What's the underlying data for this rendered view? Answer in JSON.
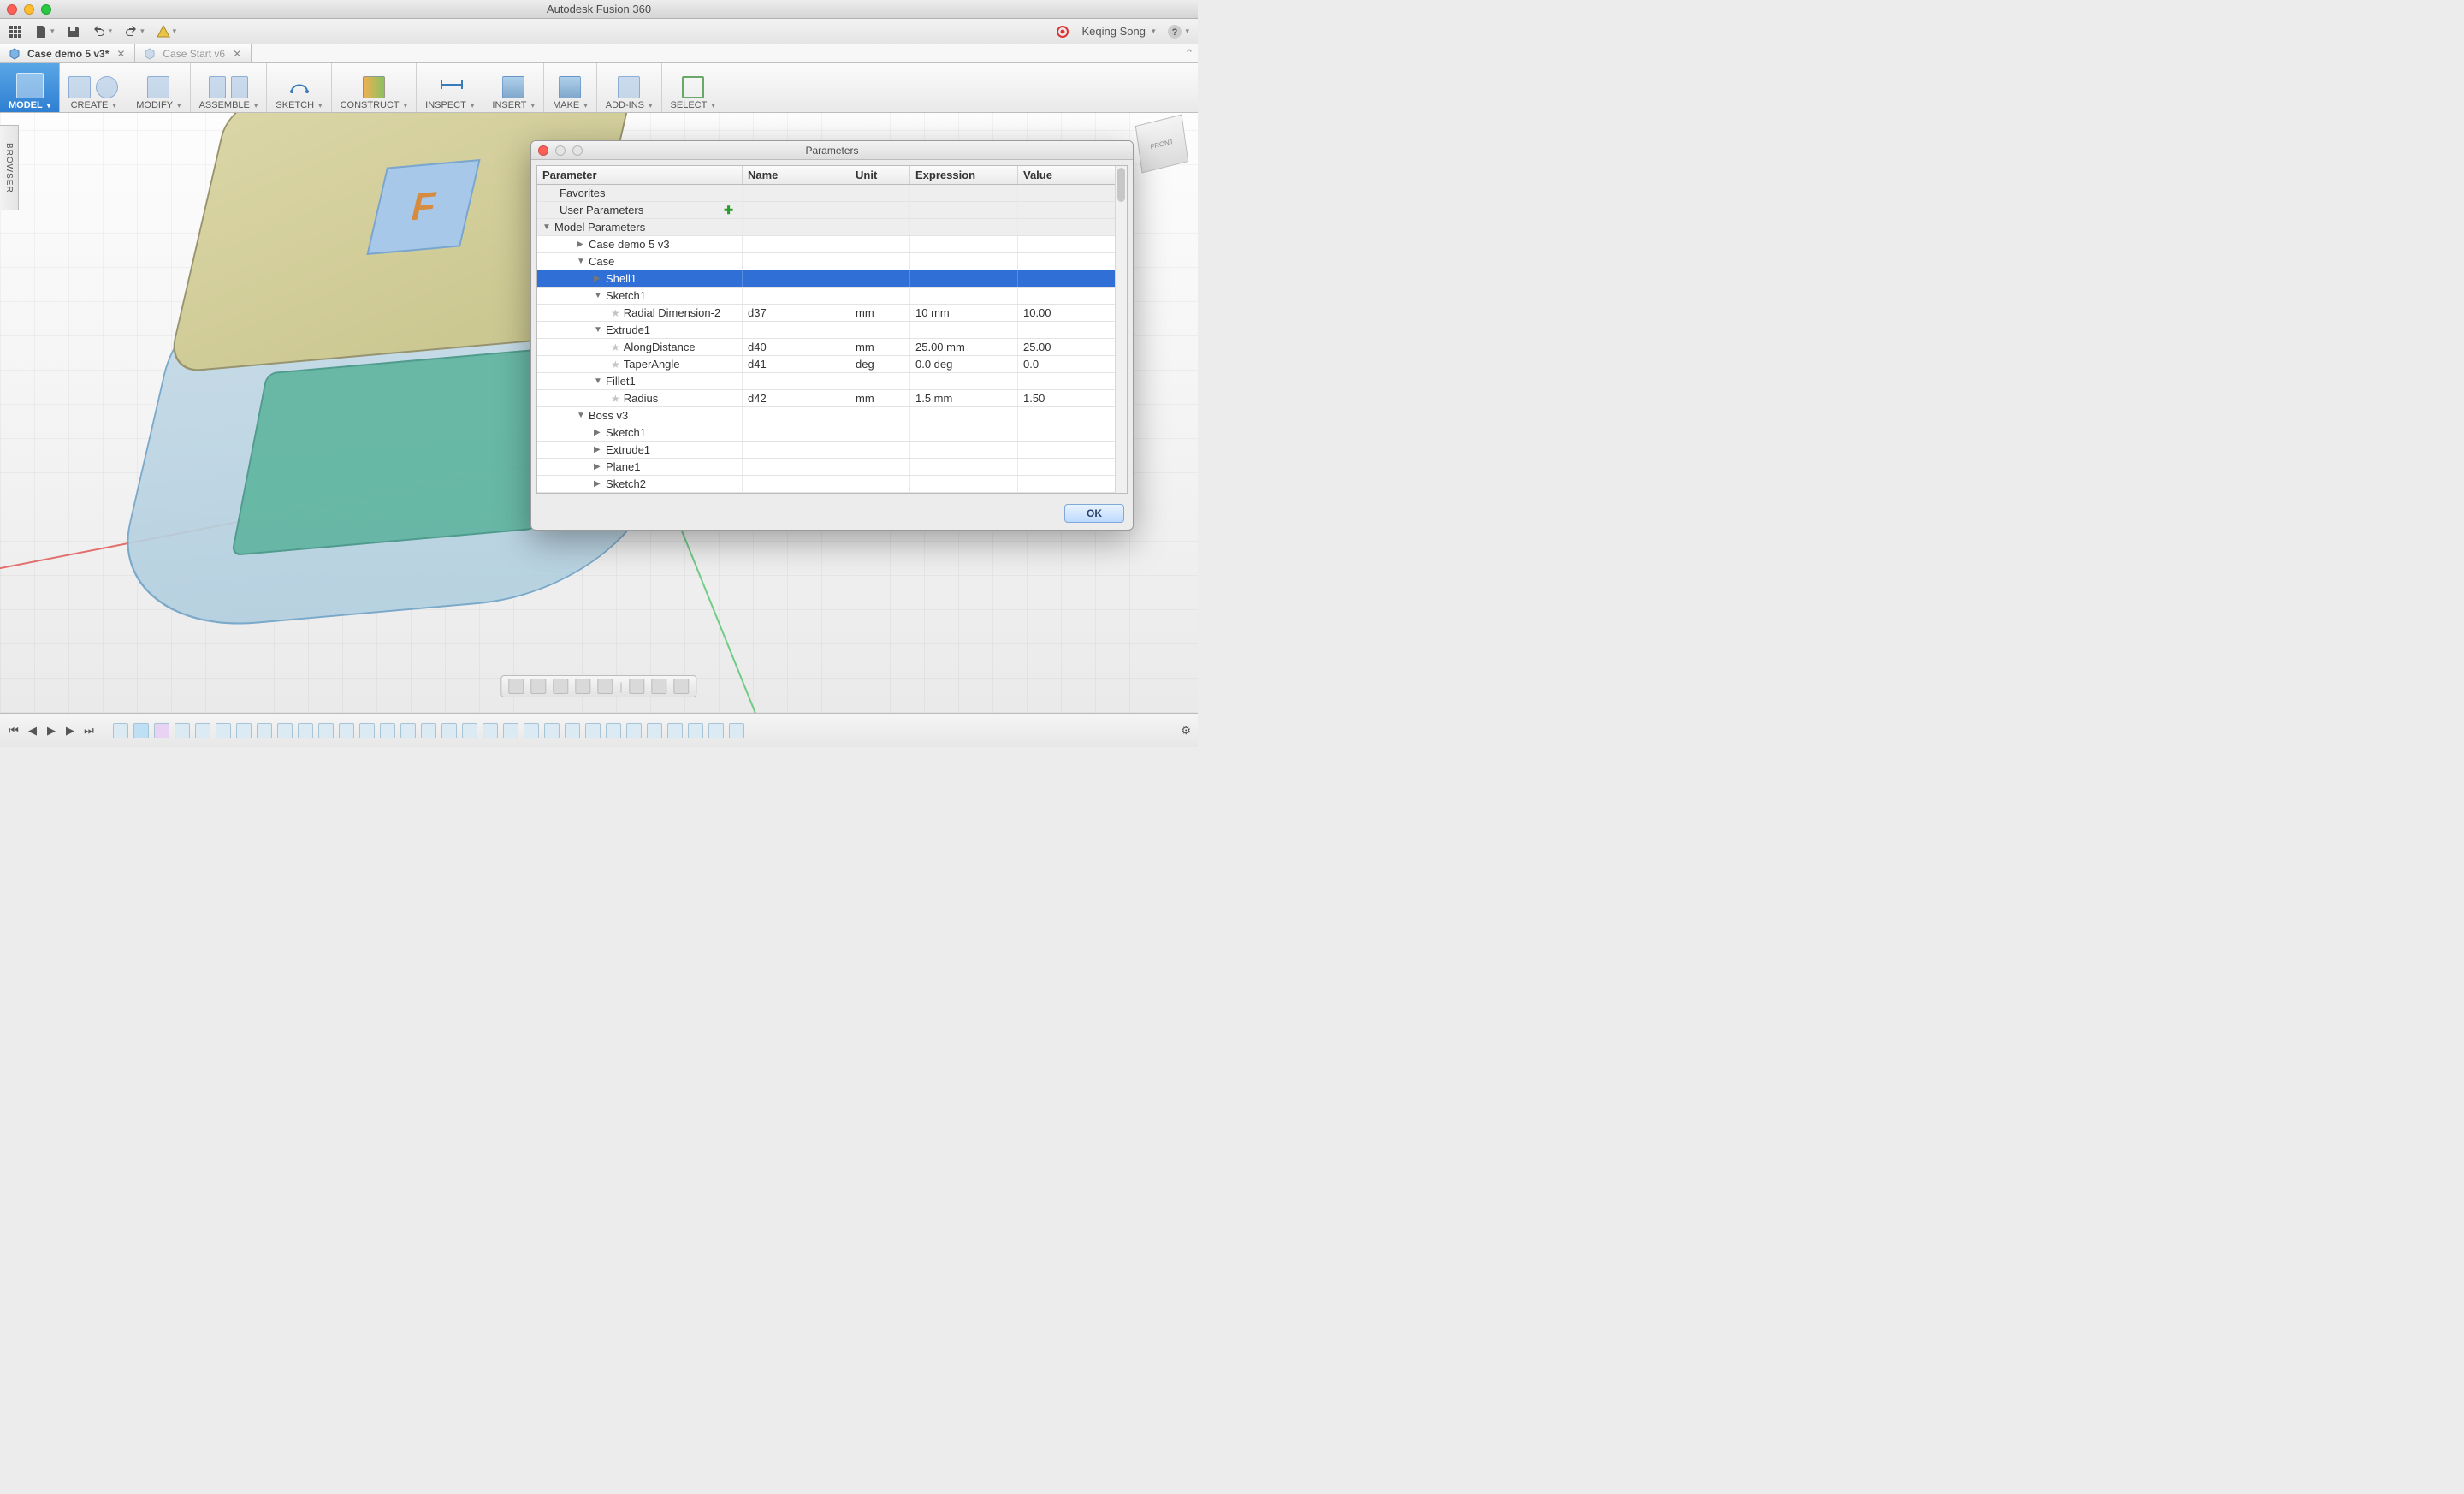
{
  "window": {
    "title": "Autodesk Fusion 360"
  },
  "user": {
    "name": "Keqing Song"
  },
  "tabs": [
    {
      "label": "Case demo 5 v3*",
      "active": true
    },
    {
      "label": "Case Start v6",
      "active": false
    }
  ],
  "browserTab": "BROWSER",
  "ribbon": {
    "model": "MODEL",
    "groups": [
      {
        "id": "create",
        "label": "CREATE"
      },
      {
        "id": "modify",
        "label": "MODIFY"
      },
      {
        "id": "assemble",
        "label": "ASSEMBLE"
      },
      {
        "id": "sketch",
        "label": "SKETCH"
      },
      {
        "id": "construct",
        "label": "CONSTRUCT"
      },
      {
        "id": "inspect",
        "label": "INSPECT"
      },
      {
        "id": "insert",
        "label": "INSERT"
      },
      {
        "id": "make",
        "label": "MAKE"
      },
      {
        "id": "addins",
        "label": "ADD-INS"
      },
      {
        "id": "select",
        "label": "SELECT"
      }
    ]
  },
  "viewcube": "FRONT",
  "decal": "F",
  "dialog": {
    "title": "Parameters",
    "columns": {
      "parameter": "Parameter",
      "name": "Name",
      "unit": "Unit",
      "expression": "Expression",
      "value": "Value"
    },
    "rows": [
      {
        "type": "group",
        "indent": 1,
        "label": "Favorites"
      },
      {
        "type": "group",
        "indent": 1,
        "label": "User Parameters",
        "plus": true
      },
      {
        "type": "group",
        "indent": 0,
        "label": "Model Parameters",
        "twisty": "▼"
      },
      {
        "type": "node",
        "indent": 2,
        "label": "Case demo 5 v3",
        "twisty": "▶"
      },
      {
        "type": "node",
        "indent": 2,
        "label": "Case",
        "twisty": "▼"
      },
      {
        "type": "selected",
        "indent": 3,
        "label": "Shell1",
        "twisty": "▶"
      },
      {
        "type": "node",
        "indent": 3,
        "label": "Sketch1",
        "twisty": "▼"
      },
      {
        "type": "leaf",
        "indent": 4,
        "label": "Radial Dimension-2",
        "name": "d37",
        "unit": "mm",
        "expression": "10 mm",
        "value": "10.00"
      },
      {
        "type": "node",
        "indent": 3,
        "label": "Extrude1",
        "twisty": "▼"
      },
      {
        "type": "leaf",
        "indent": 4,
        "label": "AlongDistance",
        "name": "d40",
        "unit": "mm",
        "expression": "25.00 mm",
        "value": "25.00"
      },
      {
        "type": "leaf",
        "indent": 4,
        "label": "TaperAngle",
        "name": "d41",
        "unit": "deg",
        "expression": "0.0 deg",
        "value": "0.0"
      },
      {
        "type": "node",
        "indent": 3,
        "label": "Fillet1",
        "twisty": "▼"
      },
      {
        "type": "leaf",
        "indent": 4,
        "label": "Radius",
        "name": "d42",
        "unit": "mm",
        "expression": "1.5 mm",
        "value": "1.50"
      },
      {
        "type": "node",
        "indent": 2,
        "label": "Boss v3",
        "twisty": "▼"
      },
      {
        "type": "node",
        "indent": 3,
        "label": "Sketch1",
        "twisty": "▶"
      },
      {
        "type": "node",
        "indent": 3,
        "label": "Extrude1",
        "twisty": "▶"
      },
      {
        "type": "node",
        "indent": 3,
        "label": "Plane1",
        "twisty": "▶"
      },
      {
        "type": "node",
        "indent": 3,
        "label": "Sketch2",
        "twisty": "▶"
      }
    ],
    "ok": "OK"
  }
}
